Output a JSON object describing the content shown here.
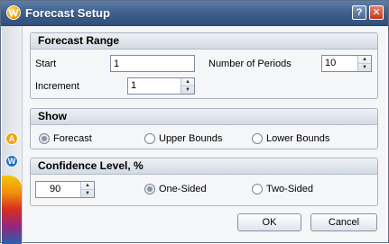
{
  "window": {
    "title": "Forecast Setup",
    "help_label": "?",
    "close_label": "✕"
  },
  "sidebar": {
    "logo_a": "A",
    "logo_w": "W"
  },
  "forecast_range": {
    "header": "Forecast Range",
    "start_label": "Start",
    "start_value": "1",
    "periods_label": "Number of Periods",
    "periods_value": "10",
    "increment_label": "Increment",
    "increment_value": "1"
  },
  "show": {
    "header": "Show",
    "options": [
      {
        "label": "Forecast",
        "checked": true
      },
      {
        "label": "Upper Bounds",
        "checked": false
      },
      {
        "label": "Lower Bounds",
        "checked": false
      }
    ]
  },
  "confidence": {
    "header": "Confidence Level, %",
    "level_value": "90",
    "options": [
      {
        "label": "One-Sided",
        "checked": true
      },
      {
        "label": "Two-Sided",
        "checked": false
      }
    ]
  },
  "buttons": {
    "ok": "OK",
    "cancel": "Cancel"
  },
  "spinner_glyphs": {
    "up": "▲",
    "down": "▼"
  }
}
